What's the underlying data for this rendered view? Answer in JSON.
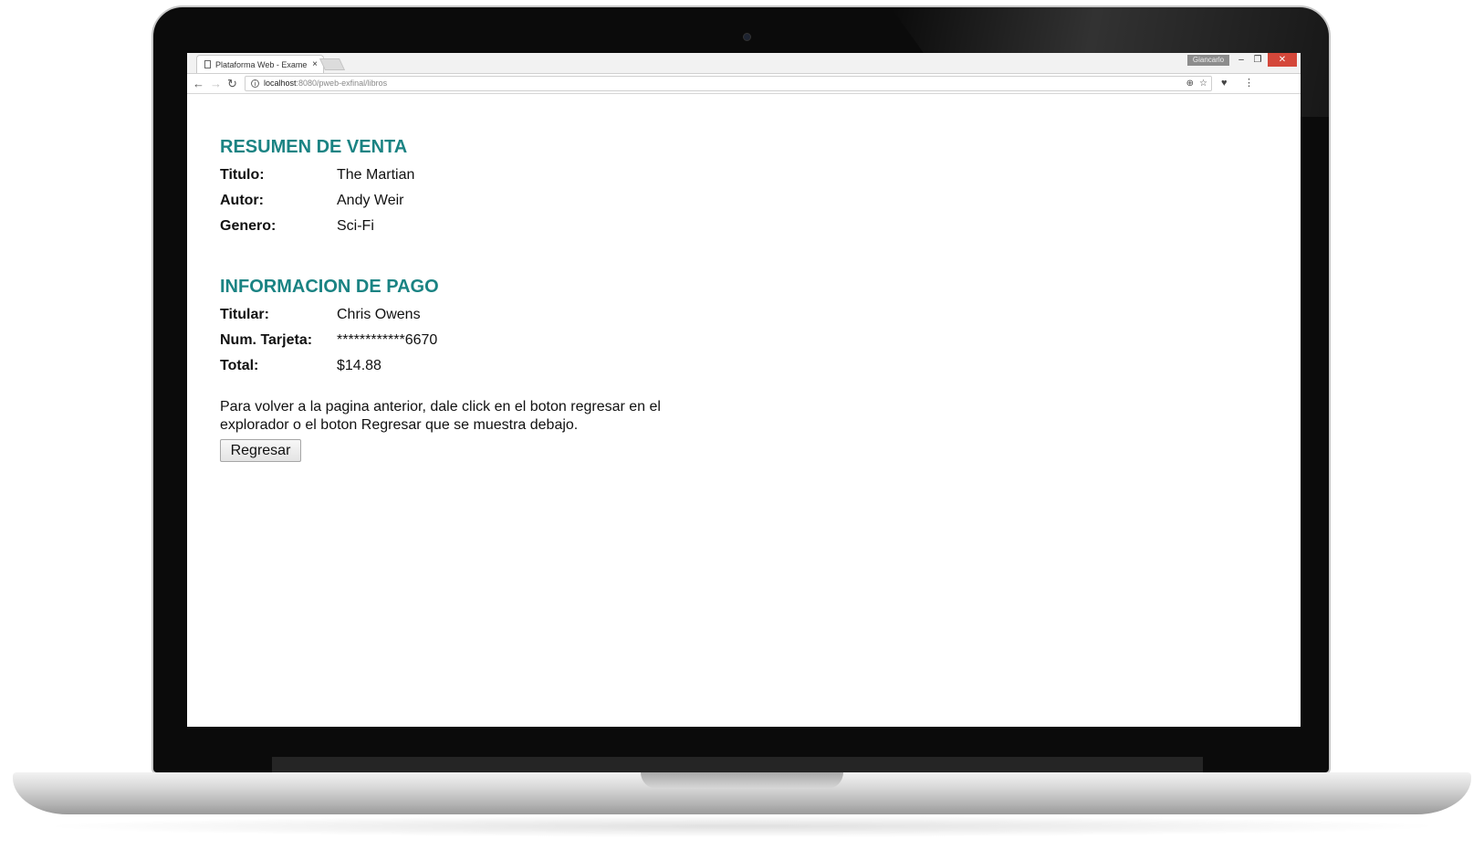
{
  "browser": {
    "tab_title": "Plataforma Web - Exame",
    "tab_close": "×",
    "profile_name": "Giancarlo",
    "window_controls": {
      "minimize": "–",
      "maximize": "❐",
      "close": "✕"
    },
    "nav": {
      "back": "←",
      "forward": "→",
      "reload": "↻"
    },
    "url_host": "localhost",
    "url_rest": ":8080/pweb-exfinal/libros",
    "icons": [
      "page-icon",
      "info-icon",
      "zoom-icon",
      "star-icon",
      "pocket-icon",
      "menu-icon"
    ]
  },
  "page": {
    "sale_heading": "RESUMEN DE VENTA",
    "sale_rows": [
      {
        "label": "Titulo:",
        "value": "The Martian"
      },
      {
        "label": "Autor:",
        "value": "Andy Weir"
      },
      {
        "label": "Genero:",
        "value": "Sci-Fi"
      }
    ],
    "payment_heading": "INFORMACION DE PAGO",
    "payment_rows": [
      {
        "label": "Titular:",
        "value": "Chris Owens"
      },
      {
        "label": "Num. Tarjeta:",
        "value": "************6670"
      },
      {
        "label": "Total:",
        "value": "$14.88"
      }
    ],
    "note": "Para volver a la pagina anterior, dale click en el boton regresar en el explorador o el boton Regresar que se muestra debajo.",
    "back_button": "Regresar"
  },
  "colors": {
    "heading": "#1a8383",
    "close_button": "#d4473a"
  }
}
